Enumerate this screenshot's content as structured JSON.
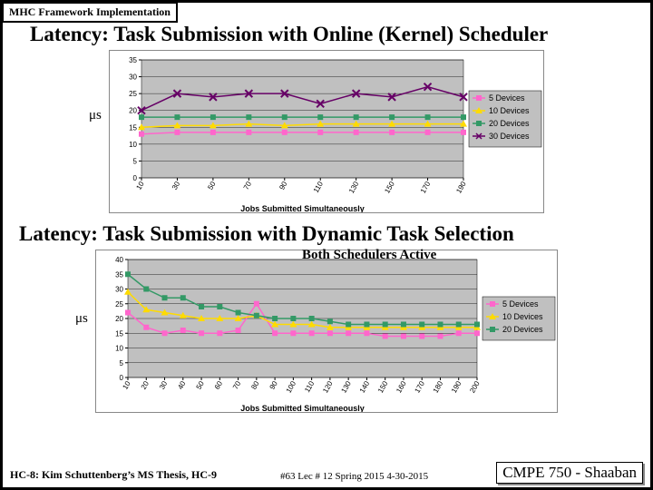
{
  "tag": "MHC Framework Implementation",
  "heading1": "Latency: Task Submission with Online (Kernel) Scheduler",
  "heading2": "Latency: Task Submission with Dynamic Task Selection",
  "both_active": "Both Schedulers Active",
  "mus": "μs",
  "footer": {
    "left": "HC-8: Kim Schuttenberg’s MS Thesis, HC-9",
    "center": "#63   Lec # 12   Spring 2015  4-30-2015",
    "right": "CMPE 750 - Shaaban"
  },
  "chart_data": [
    {
      "type": "line",
      "title": "",
      "xlabel": "Jobs Submitted Simultaneously",
      "ylabel": "",
      "ylim": [
        0,
        35
      ],
      "yticks": [
        0,
        5,
        10,
        15,
        20,
        25,
        30,
        35
      ],
      "x": [
        10,
        30,
        50,
        70,
        90,
        110,
        130,
        150,
        170,
        190
      ],
      "series": [
        {
          "name": "5 Devices",
          "color": "#ff66cc",
          "marker": "square",
          "values": [
            13,
            13.5,
            13.5,
            13.5,
            13.5,
            13.5,
            13.5,
            13.5,
            13.5,
            13.5
          ]
        },
        {
          "name": "10 Devices",
          "color": "#ffdb00",
          "marker": "triangle",
          "values": [
            15,
            15.5,
            15.5,
            16,
            15.5,
            16,
            16,
            16,
            16,
            16
          ]
        },
        {
          "name": "20 Devices",
          "color": "#339966",
          "marker": "square",
          "values": [
            18,
            18,
            18,
            18,
            18,
            18,
            18,
            18,
            18,
            18
          ]
        },
        {
          "name": "30 Devices",
          "color": "#660066",
          "marker": "x",
          "values": [
            20,
            25,
            24,
            25,
            25,
            22,
            25,
            24,
            27,
            24
          ]
        }
      ]
    },
    {
      "type": "line",
      "title": "",
      "xlabel": "Jobs Submitted Simultaneously",
      "ylabel": "",
      "ylim": [
        0,
        40
      ],
      "yticks": [
        0,
        5,
        10,
        15,
        20,
        25,
        30,
        35,
        40
      ],
      "x": [
        10,
        20,
        30,
        40,
        50,
        60,
        70,
        80,
        90,
        100,
        110,
        120,
        130,
        140,
        150,
        160,
        170,
        180,
        190,
        200
      ],
      "series": [
        {
          "name": "5 Devices",
          "color": "#ff66cc",
          "marker": "square",
          "values": [
            22,
            17,
            15,
            16,
            15,
            15,
            16,
            25,
            15,
            15,
            15,
            15,
            15,
            15,
            14,
            14,
            14,
            14,
            15,
            15
          ]
        },
        {
          "name": "10 Devices",
          "color": "#ffdb00",
          "marker": "triangle",
          "values": [
            29,
            23,
            22,
            21,
            20,
            20,
            20,
            21,
            18,
            18,
            18,
            17,
            17,
            17,
            17,
            17,
            17,
            17,
            17,
            17
          ]
        },
        {
          "name": "20 Devices",
          "color": "#339966",
          "marker": "square",
          "values": [
            35,
            30,
            27,
            27,
            24,
            24,
            22,
            21,
            20,
            20,
            20,
            19,
            18,
            18,
            18,
            18,
            18,
            18,
            18,
            18
          ]
        }
      ]
    }
  ]
}
